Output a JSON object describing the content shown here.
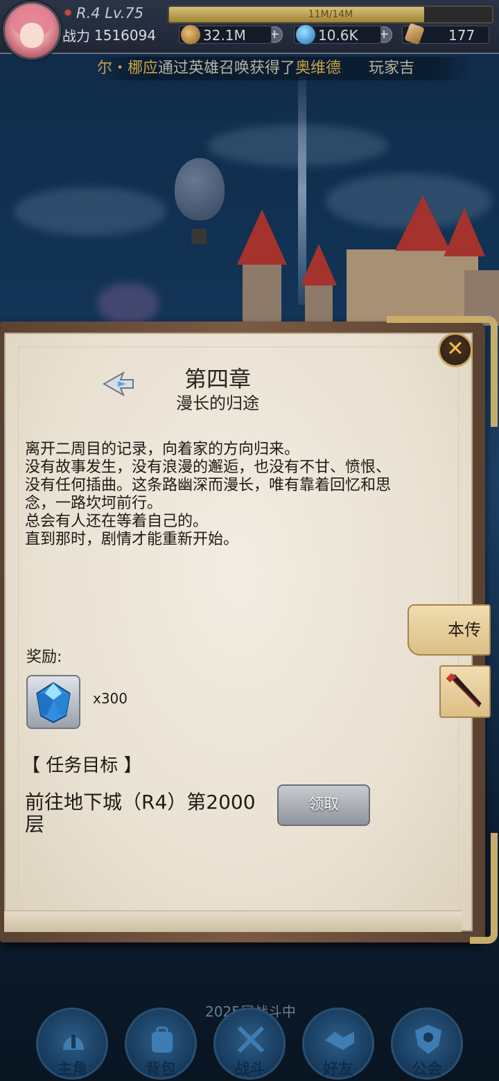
{
  "hud": {
    "rank_level": "R.4 Lv.75",
    "exp_text": "11M/14M",
    "exp_progress": 0.79,
    "power_label": "战力",
    "power_value": "1516094",
    "gold": "32.1M",
    "crystal": "10.6K",
    "scroll": "177"
  },
  "ticker": {
    "part1": "尔・梛应",
    "part2": "通过英雄召唤获得了",
    "part3": "奥维德",
    "part4": "玩家吉"
  },
  "dialog": {
    "title": "第四章",
    "subtitle": "漫长的归途",
    "story": "离开二周目的记录，向着家的方向归来。\n没有故事发生，没有浪漫的邂逅，也没有不甘、愤恨、没有任何插曲。这条路幽深而漫长，唯有靠着回忆和思念，一路坎坷前行。\n总会有人还在等着自己的。\n直到那时，剧情才能重新开始。",
    "reward_label": "奖励:",
    "reward_qty": "x300",
    "task_header": "【 任务目标 】",
    "task_text": "前往地下城（R4）第2000层",
    "claim_label": "领取",
    "side_tab_label": "本传"
  },
  "nav": {
    "floor_text": "2025层战斗中",
    "items": [
      {
        "label": "主角"
      },
      {
        "label": "背包"
      },
      {
        "label": "战斗"
      },
      {
        "label": "好友"
      },
      {
        "label": "公会"
      }
    ]
  },
  "colors": {
    "gold_text": "#c8a348",
    "paper": "#ece5d8",
    "frame": "#6a4e3a",
    "nav_blue": "#1d4a70"
  }
}
